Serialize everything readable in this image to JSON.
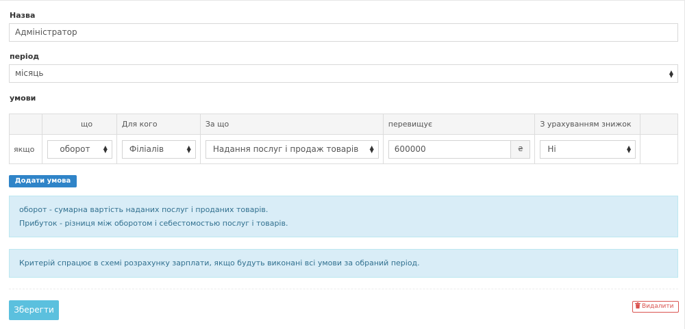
{
  "form": {
    "name_label": "Назва",
    "name_value": "Адміністратор",
    "period_label": "період",
    "period_value": "місяць",
    "conditions_label": "умови"
  },
  "table": {
    "headers": [
      "",
      "що",
      "Для кого",
      "За що",
      "перевищує",
      "З урахуванням знижок",
      ""
    ],
    "row": {
      "prefix": "якщо",
      "what": "оборот",
      "for_whom": "Філіалів",
      "for_what": "Надання послуг і продаж товарів",
      "exceeds_value": "600000",
      "currency": "₴",
      "with_discounts": "Ні"
    }
  },
  "buttons": {
    "add_condition": "Додати умова",
    "save": "Зберегти",
    "delete": "Видалити"
  },
  "info": {
    "line1": "оборот - сумарна вартість наданих послуг і проданих товарів.",
    "line2": "Прибуток - різниця між оборотом і себестомостью послуг і товарів.",
    "note": "Критерій спрацює в схемі розрахунку зарплати, якщо будуть виконані всі умови за обраний період."
  },
  "icons": {
    "select_arrow": "sort-arrows-icon",
    "delete": "trash-icon"
  },
  "colors": {
    "primary": "#2f84c8",
    "info_bg": "#d9edf7",
    "info_text": "#31708f",
    "save": "#5bc0de",
    "danger": "#d9534f"
  }
}
